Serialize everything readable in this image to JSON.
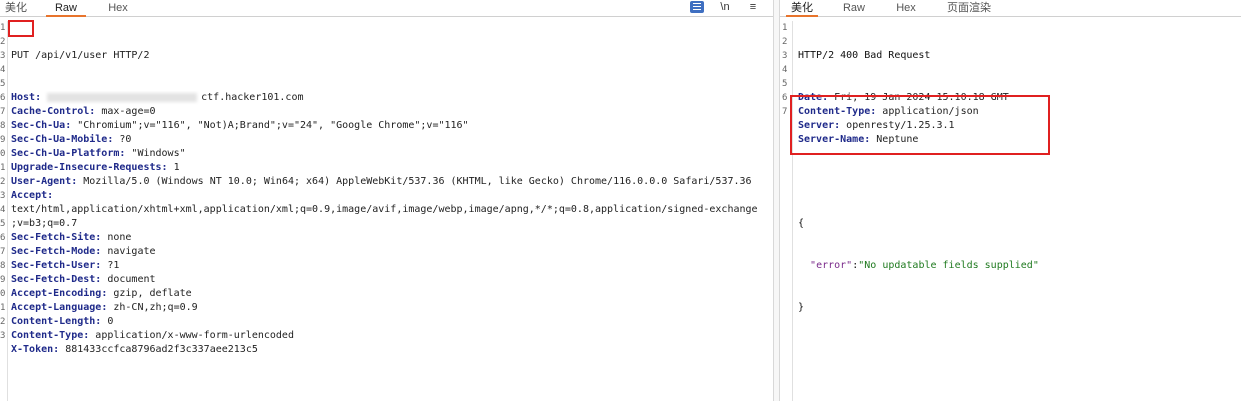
{
  "request_pane": {
    "tabs": [
      "美化",
      "Raw",
      "Hex"
    ],
    "active_tab": "Raw",
    "toolbar": {
      "newline_label": "\\n",
      "menu_label": "≡"
    },
    "line_numbers": [
      "1",
      "2",
      "3",
      "4",
      "5",
      "6",
      "7",
      "8",
      "9",
      "0",
      "1",
      "2",
      "3",
      "4",
      "5",
      "6",
      "7",
      "8",
      "9",
      "0",
      "1",
      "2",
      "3"
    ],
    "request_line": {
      "method": "PUT",
      "rest": " /api/v1/user HTTP/2"
    },
    "headers": [
      {
        "key": "Host",
        "value": "ctf.hacker101.com",
        "has_redaction": true
      },
      {
        "key": "Cache-Control",
        "value": "max-age=0"
      },
      {
        "key": "Sec-Ch-Ua",
        "value": "\"Chromium\";v=\"116\", \"Not)A;Brand\";v=\"24\", \"Google Chrome\";v=\"116\""
      },
      {
        "key": "Sec-Ch-Ua-Mobile",
        "value": "?0"
      },
      {
        "key": "Sec-Ch-Ua-Platform",
        "value": "\"Windows\""
      },
      {
        "key": "Upgrade-Insecure-Requests",
        "value": "1"
      },
      {
        "key": "User-Agent",
        "value": "Mozilla/5.0 (Windows NT 10.0; Win64; x64) AppleWebKit/537.36 (KHTML, like Gecko) Chrome/116.0.0.0 Safari/537.36"
      },
      {
        "key": "Accept",
        "value": ""
      }
    ],
    "accept_continuation": [
      "text/html,application/xhtml+xml,application/xml;q=0.9,image/avif,image/webp,image/apng,*/*;q=0.8,application/signed-exchange",
      ";v=b3;q=0.7"
    ],
    "headers_after": [
      {
        "key": "Sec-Fetch-Site",
        "value": "none"
      },
      {
        "key": "Sec-Fetch-Mode",
        "value": "navigate"
      },
      {
        "key": "Sec-Fetch-User",
        "value": "?1"
      },
      {
        "key": "Sec-Fetch-Dest",
        "value": "document"
      },
      {
        "key": "Accept-Encoding",
        "value": "gzip, deflate"
      },
      {
        "key": "Accept-Language",
        "value": "zh-CN,zh;q=0.9"
      },
      {
        "key": "Content-Length",
        "value": "0"
      },
      {
        "key": "Content-Type",
        "value": "application/x-www-form-urlencoded"
      },
      {
        "key": "X-Token",
        "value": "881433ccfca8796ad2f3c337aee213c5"
      }
    ]
  },
  "response_pane": {
    "tabs": [
      "美化",
      "Raw",
      "Hex",
      "页面渲染"
    ],
    "active_tab": "美化",
    "line_numbers": [
      "1",
      "2",
      "3",
      "4",
      "5",
      "6",
      "7"
    ],
    "status_line": "HTTP/2 400 Bad Request",
    "headers": [
      {
        "key": "Date",
        "value": "Fri, 19 Jan 2024 15:10:18 GMT"
      },
      {
        "key": "Content-Type",
        "value": "application/json"
      },
      {
        "key": "Server",
        "value": "openresty/1.25.3.1"
      },
      {
        "key": "Server-Name",
        "value": "Neptune"
      }
    ],
    "body": {
      "open_brace": "{",
      "json_key": "\"error\"",
      "json_colon": ":",
      "json_value": "\"No updatable fields supplied\"",
      "close_brace": "}"
    }
  },
  "colors": {
    "highlight_box": "#e02020",
    "active_tab_underline": "#e8742c",
    "header_key": "#1f2a8a",
    "json_string": "#1f7a1f"
  }
}
